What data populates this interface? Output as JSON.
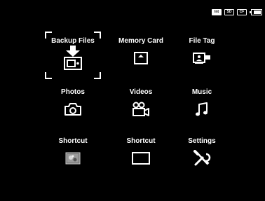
{
  "status_bar": {
    "cards": [
      {
        "icon": "internal-memory-icon",
        "label": "Int"
      },
      {
        "icon": "sd-card-icon",
        "label": "SD"
      },
      {
        "icon": "cf-card-icon",
        "label": "CF"
      }
    ],
    "battery_icon": "battery-icon",
    "battery_level": 0.8
  },
  "menu": {
    "selected": "Backup Files",
    "items": [
      {
        "label": "Backup Files",
        "icon": "backup-icon"
      },
      {
        "label": "Memory Card",
        "icon": "memory-card-icon"
      },
      {
        "label": "File Tag",
        "icon": "file-tag-icon"
      },
      {
        "label": "Photos",
        "icon": "camera-icon"
      },
      {
        "label": "Videos",
        "icon": "video-camera-icon"
      },
      {
        "label": "Music",
        "icon": "music-note-icon"
      },
      {
        "label": "Shortcut",
        "icon": "shortcut-image-icon"
      },
      {
        "label": "Shortcut",
        "icon": "shortcut-empty-icon"
      },
      {
        "label": "Settings",
        "icon": "settings-tools-icon"
      }
    ]
  }
}
